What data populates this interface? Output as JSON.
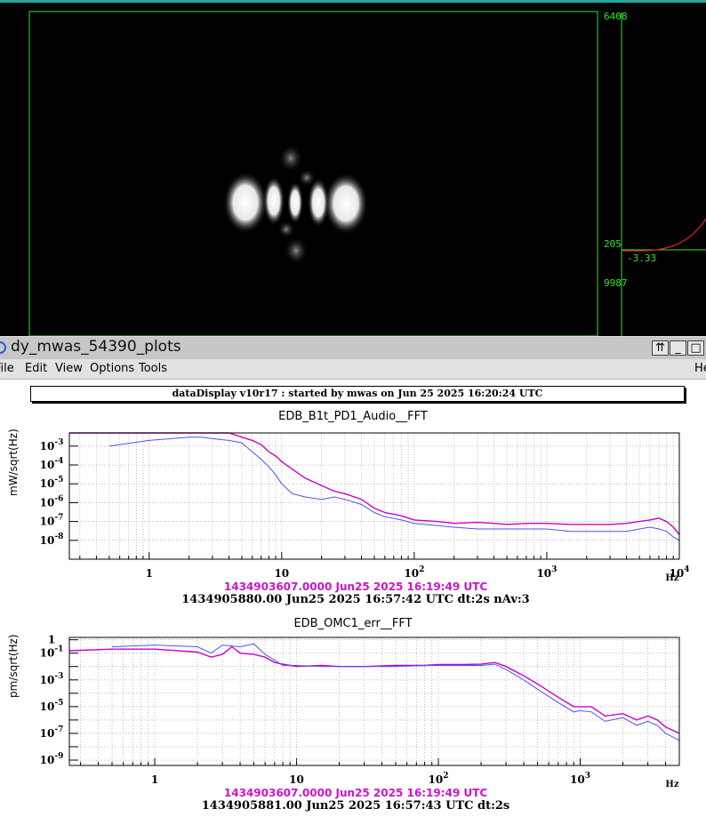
{
  "viewer": {
    "scale_max_1": "6408",
    "scale_mid": "205",
    "scale_neg": "-3.33",
    "scale_max_2": "9987"
  },
  "window": {
    "title": "dy_mwas_54390_plots",
    "buttons": [
      "⇈",
      "_",
      "□"
    ]
  },
  "menu": {
    "items": [
      "File",
      "Edit",
      "View",
      "Options",
      "Tools"
    ],
    "help": "He"
  },
  "banner": "dataDisplay v10r17 : started by mwas on Jun 25 2025 16:20:24 UTC",
  "colors": {
    "trace_magenta": "#cc00cc",
    "trace_blue": "#4a55ee",
    "accent_teal": "#27a5a0",
    "scale_green": "#2ee62e"
  },
  "chart_data": [
    {
      "type": "line",
      "title": "EDB_B1t_PD1_Audio__FFT",
      "ylabel": "mW/sqrt(Hz)",
      "xlabel": "Hz",
      "x_scale": "log",
      "y_scale": "log",
      "xlim": [
        0.25,
        10000
      ],
      "ylim": [
        1e-09,
        0.005
      ],
      "x_ticks": [
        {
          "v": 1,
          "label": "1"
        },
        {
          "v": 10,
          "label": "10"
        },
        {
          "v": 100,
          "label": "10",
          "sup": "2"
        },
        {
          "v": 1000,
          "label": "10",
          "sup": "3"
        },
        {
          "v": 10000,
          "label": "10",
          "sup": "4"
        }
      ],
      "y_ticks": [
        {
          "v": 0.001,
          "label": "10",
          "sup": "-3"
        },
        {
          "v": 0.0001,
          "label": "10",
          "sup": "-4"
        },
        {
          "v": 1e-05,
          "label": "10",
          "sup": "-5"
        },
        {
          "v": 1e-06,
          "label": "10",
          "sup": "-6"
        },
        {
          "v": 1e-07,
          "label": "10",
          "sup": "-7"
        },
        {
          "v": 1e-08,
          "label": "10",
          "sup": "-8"
        }
      ],
      "series": [
        {
          "color": "#cc00cc",
          "x": [
            0.25,
            0.5,
            1,
            2,
            2.5,
            3,
            4,
            5,
            6,
            7,
            8,
            9,
            10,
            12,
            15,
            20,
            25,
            30,
            40,
            50,
            60,
            80,
            100,
            150,
            200,
            300,
            400,
            500,
            700,
            1000,
            1500,
            2000,
            3000,
            4000,
            5000,
            6000,
            7000,
            8000,
            9000,
            10000
          ],
          "y": [
            0.005,
            0.005,
            0.005,
            0.005,
            0.005,
            0.005,
            0.005,
            0.003,
            0.002,
            0.0012,
            0.0005,
            0.0003,
            0.00015,
            6e-05,
            2e-05,
            8e-06,
            4e-06,
            3e-06,
            1.5e-06,
            5e-07,
            3e-07,
            2e-07,
            1.2e-07,
            1e-07,
            8e-08,
            9e-08,
            8e-08,
            7e-08,
            8e-08,
            8e-08,
            7e-08,
            7e-08,
            7e-08,
            8e-08,
            1e-07,
            1.2e-07,
            1.5e-07,
            1e-07,
            5e-08,
            2e-08
          ]
        },
        {
          "color": "#4a55ee",
          "x": [
            0.5,
            1,
            2,
            2.5,
            3,
            4,
            5,
            6,
            7,
            8,
            9,
            10,
            12,
            15,
            20,
            25,
            30,
            40,
            50,
            60,
            80,
            100,
            150,
            200,
            300,
            400,
            500,
            700,
            1000,
            1500,
            2000,
            3000,
            4000,
            5000,
            6000,
            7000,
            8000,
            9000,
            10000
          ],
          "y": [
            0.001,
            0.002,
            0.003,
            0.003,
            0.0025,
            0.002,
            0.0015,
            0.0005,
            0.0002,
            8e-05,
            3e-05,
            1e-05,
            3e-06,
            2e-06,
            1.5e-06,
            2e-06,
            1.5e-06,
            8e-07,
            3e-07,
            1.8e-07,
            1.2e-07,
            8e-08,
            6e-08,
            5e-08,
            4e-08,
            4e-08,
            4e-08,
            4e-08,
            4e-08,
            3e-08,
            3e-08,
            3e-08,
            3e-08,
            4e-08,
            5e-08,
            4e-08,
            3e-08,
            1.5e-08,
            1e-08
          ]
        }
      ],
      "time_ref": "1434903607.0000 Jun25 2025 16:19:49 UTC",
      "time_info": "1434905880.00 Jun25 2025 16:57:42 UTC dt:2s nAv:3"
    },
    {
      "type": "line",
      "title": "EDB_OMC1_err__FFT",
      "ylabel": "pm/sqrt(Hz)",
      "xlabel": "Hz",
      "x_scale": "log",
      "y_scale": "log",
      "xlim": [
        0.25,
        5000
      ],
      "ylim": [
        4e-10,
        1.5
      ],
      "x_ticks": [
        {
          "v": 1,
          "label": "1"
        },
        {
          "v": 10,
          "label": "10"
        },
        {
          "v": 100,
          "label": "10",
          "sup": "2"
        },
        {
          "v": 1000,
          "label": "10",
          "sup": "3"
        }
      ],
      "y_ticks": [
        {
          "v": 1,
          "label": "1"
        },
        {
          "v": 0.1,
          "label": "10",
          "sup": "-1"
        },
        {
          "v": 0.001,
          "label": "10",
          "sup": "-3"
        },
        {
          "v": 1e-05,
          "label": "10",
          "sup": "-5"
        },
        {
          "v": 1e-07,
          "label": "10",
          "sup": "-7"
        },
        {
          "v": 1e-09,
          "label": "10",
          "sup": "-9"
        }
      ],
      "series": [
        {
          "color": "#cc00cc",
          "x": [
            0.25,
            0.5,
            1,
            2,
            2.5,
            3,
            3.5,
            4,
            5,
            6,
            7,
            8,
            10,
            15,
            20,
            30,
            50,
            80,
            100,
            150,
            200,
            250,
            300,
            400,
            500,
            700,
            900,
            1000,
            1200,
            1500,
            2000,
            2500,
            3000,
            3500,
            4000,
            5000
          ],
          "y": [
            0.15,
            0.2,
            0.2,
            0.12,
            0.05,
            0.08,
            0.3,
            0.1,
            0.08,
            0.05,
            0.02,
            0.015,
            0.01,
            0.012,
            0.01,
            0.01,
            0.012,
            0.012,
            0.014,
            0.014,
            0.015,
            0.02,
            0.01,
            0.002,
            0.0005,
            5e-05,
            1e-05,
            1e-05,
            1e-05,
            2e-06,
            3e-06,
            1e-06,
            2e-06,
            1e-06,
            3e-07,
            1e-07
          ]
        },
        {
          "color": "#4a55ee",
          "x": [
            0.5,
            1,
            2,
            2.5,
            3,
            4,
            5,
            6,
            7,
            8,
            10,
            15,
            20,
            30,
            50,
            80,
            100,
            150,
            200,
            250,
            300,
            400,
            500,
            700,
            900,
            1000,
            1200,
            1500,
            2000,
            2500,
            3000,
            3500,
            4000,
            5000
          ],
          "y": [
            0.3,
            0.4,
            0.3,
            0.1,
            0.4,
            0.3,
            0.5,
            0.08,
            0.03,
            0.012,
            0.012,
            0.01,
            0.01,
            0.01,
            0.01,
            0.012,
            0.012,
            0.012,
            0.012,
            0.015,
            0.006,
            0.001,
            0.0002,
            2e-05,
            4e-06,
            5e-06,
            4e-06,
            8e-07,
            1.5e-06,
            4e-07,
            8e-07,
            4e-07,
            1e-07,
            3e-08
          ]
        }
      ],
      "time_ref": "1434903607.0000 Jun25 2025 16:19:49 UTC",
      "time_info": "1434905881.00 Jun25 2025 16:57:43 UTC dt:2s"
    }
  ]
}
